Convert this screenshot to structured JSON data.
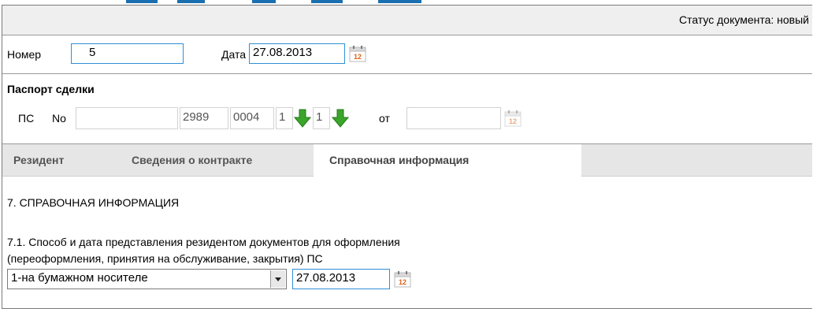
{
  "header": {
    "status_text": "Статус документа: новый"
  },
  "doc": {
    "number_label": "Номер",
    "number_value": "5",
    "date_label": "Дата",
    "date_value": "27.08.2013"
  },
  "passport": {
    "title": "Паспорт сделки",
    "ps_label": "ПС",
    "no_label": "No",
    "field1": "",
    "field2": "2989",
    "field3": "0004",
    "field4": "1",
    "field5": "1",
    "from_label": "от",
    "from_value": ""
  },
  "tabs": [
    {
      "label": "Резидент"
    },
    {
      "label": "Сведения о контракте"
    },
    {
      "label": "Справочная информация"
    }
  ],
  "active_tab": "Справочная информация",
  "section": {
    "heading": "7. СПРАВОЧНАЯ ИНФОРМАЦИЯ",
    "subheading_line1": "7.1. Способ и дата представления резидентом документов для оформления",
    "subheading_line2": "(переоформления, принятия на обслуживание, закрытия) ПС",
    "method_value": "1-на бумажном носителе",
    "method_date": "27.08.2013"
  },
  "icons": {
    "calendar": "calendar-icon",
    "arrow": "green-arrow-down-icon"
  },
  "colors": {
    "field_border": "#2f8fd6",
    "tab_bar": "#e6e6e6",
    "arrow_green": "#3aa52a"
  }
}
